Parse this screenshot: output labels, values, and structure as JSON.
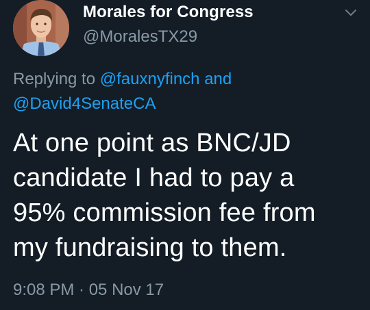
{
  "author": {
    "display_name": "Morales for Congress",
    "handle": "@MoralesTX29"
  },
  "reply": {
    "prefix": "Replying to ",
    "mentions": [
      "@fauxnyfinch",
      "@David4SenateCA"
    ],
    "conjunction": " and"
  },
  "tweet": {
    "lines": [
      "At one point as BNC/JD",
      "candidate I had to pay a",
      "95% commission fee from",
      "my fundraising to them."
    ]
  },
  "meta": {
    "timestamp": "9:08 PM · 05 Nov 17"
  },
  "icons": {
    "menu": "chevron-down-icon",
    "avatar": "profile-photo"
  },
  "colors": {
    "background": "#141d26",
    "primary_text": "#ffffff",
    "secondary_text": "#8899a6",
    "link": "#1da1f2"
  }
}
